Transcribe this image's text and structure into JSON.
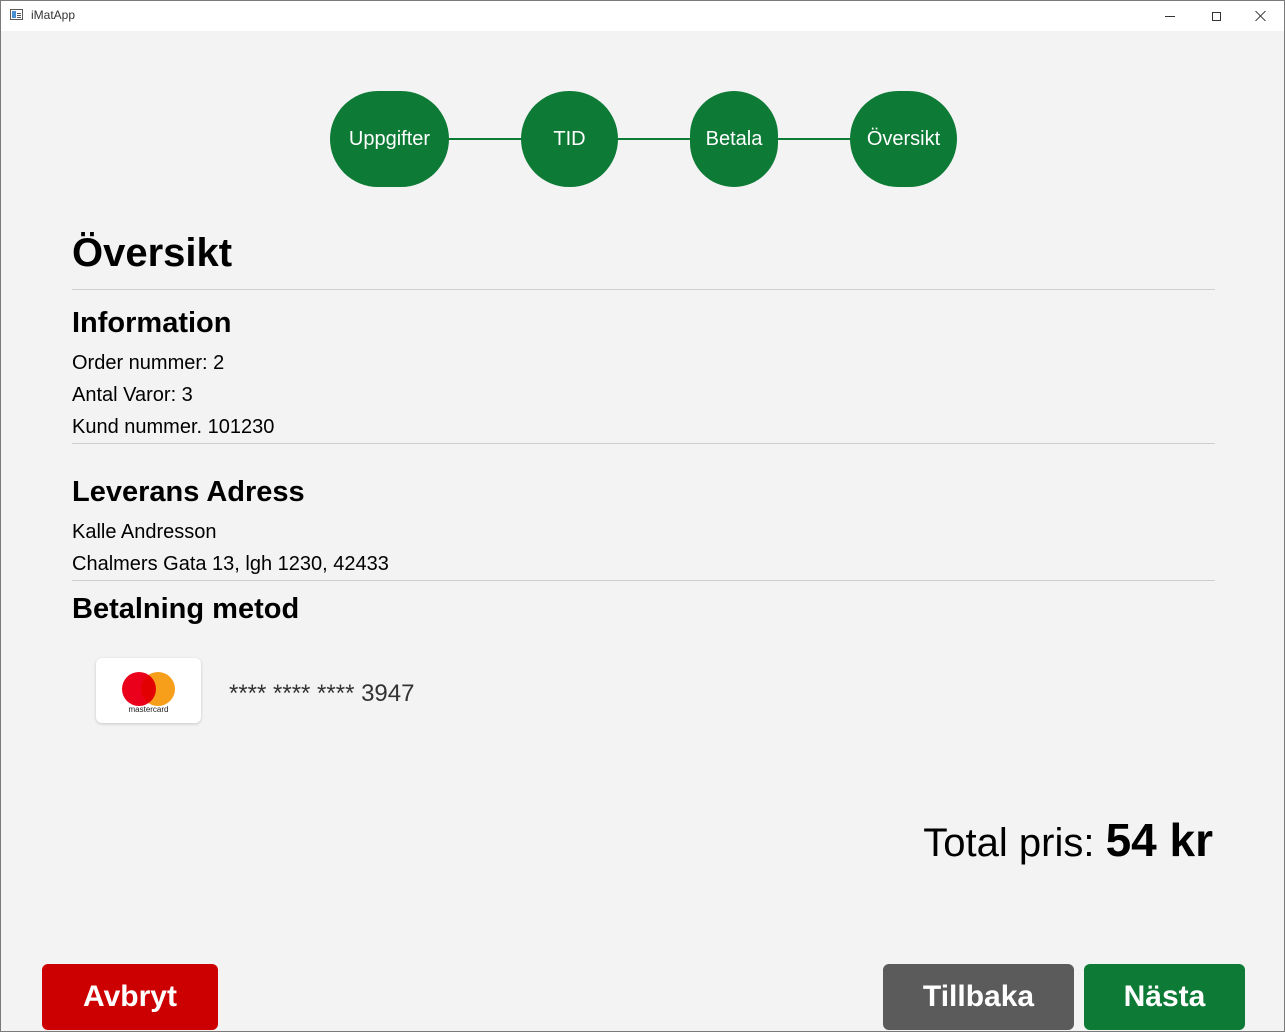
{
  "window": {
    "title": "iMatApp"
  },
  "stepper": {
    "steps": [
      {
        "label": "Uppgifter"
      },
      {
        "label": "TID"
      },
      {
        "label": "Betala"
      },
      {
        "label": "Översikt"
      }
    ],
    "color": "#0d7a36"
  },
  "page": {
    "title": "Översikt"
  },
  "information": {
    "heading": "Information",
    "order_number": "Order nummer: 2",
    "item_count": "Antal Varor: 3",
    "customer_number": "Kund nummer. 101230"
  },
  "delivery": {
    "heading": "Leverans Adress",
    "name": "Kalle Andresson",
    "address": "Chalmers Gata 13, lgh 1230, 42433"
  },
  "payment": {
    "heading": "Betalning metod",
    "card_brand": "mastercard",
    "card_number": "**** **** **** 3947"
  },
  "total": {
    "label": "Total pris: ",
    "value": "54 kr"
  },
  "buttons": {
    "cancel": "Avbryt",
    "back": "Tillbaka",
    "next": "Nästa"
  },
  "colors": {
    "cancel": "#cc0000",
    "back": "#5b5b5b",
    "next": "#0d7a36"
  }
}
